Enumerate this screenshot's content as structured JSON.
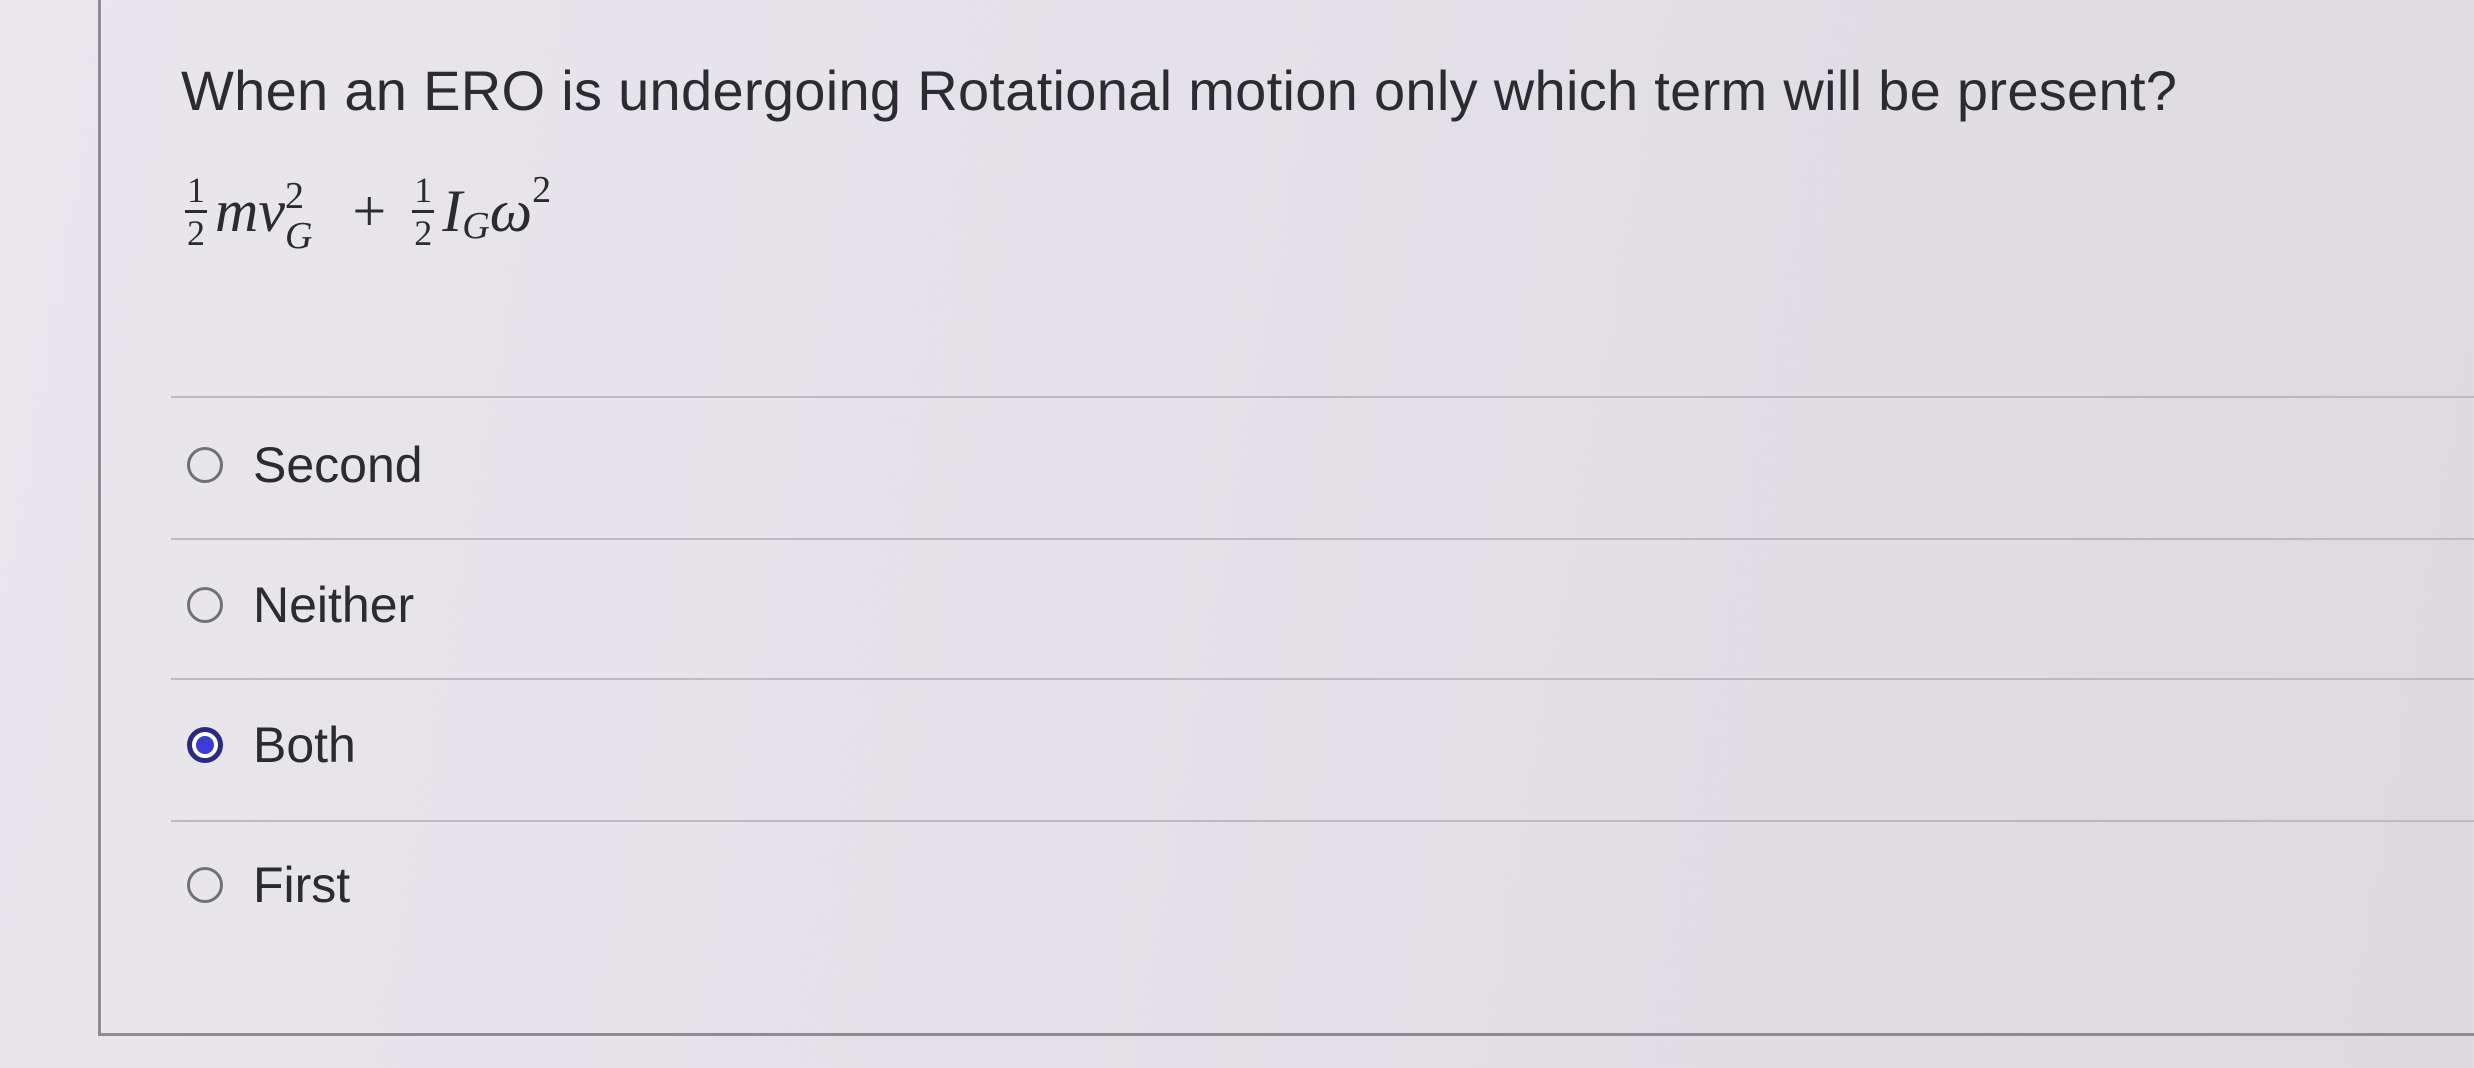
{
  "question": {
    "text": "When an ERO is undergoing Rotational motion only which term will be present?"
  },
  "formula": {
    "term1": {
      "frac_num": "1",
      "frac_den": "2",
      "body": "mv",
      "sup": "2",
      "sub": "G"
    },
    "operator": "+",
    "term2": {
      "frac_num": "1",
      "frac_den": "2",
      "body": "I",
      "sub": "G",
      "body2": "ω",
      "sup": "2"
    }
  },
  "options": [
    {
      "label": "Second",
      "selected": false
    },
    {
      "label": "Neither",
      "selected": false
    },
    {
      "label": "Both",
      "selected": true
    },
    {
      "label": "First",
      "selected": false
    }
  ],
  "colors": {
    "selected_radio": "#3b3bd6",
    "selected_ring": "#2a2a80"
  }
}
